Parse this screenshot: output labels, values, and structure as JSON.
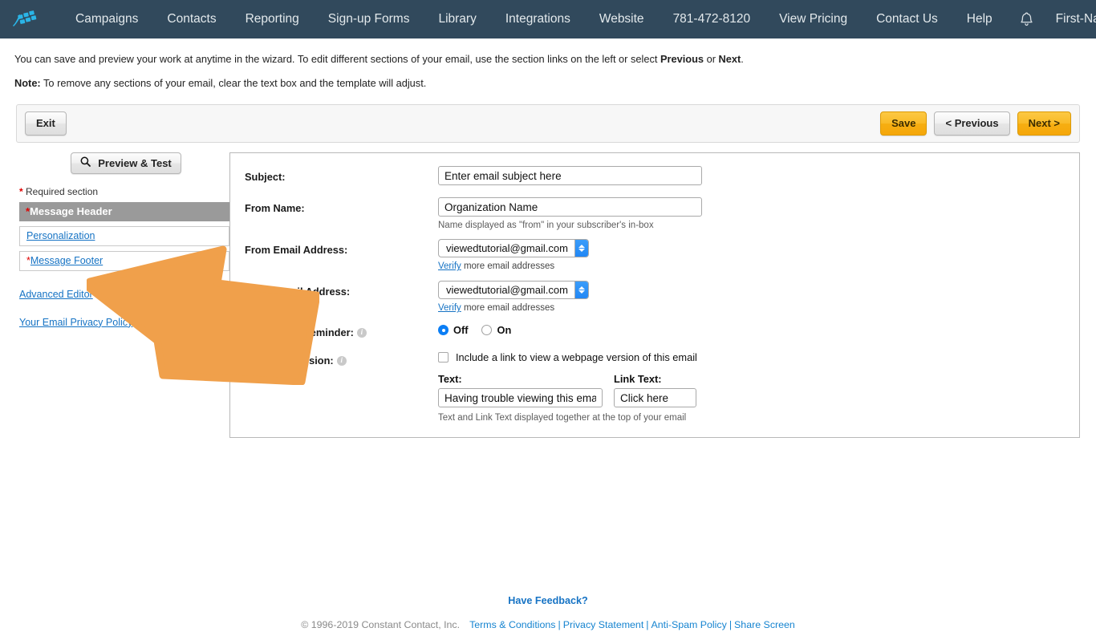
{
  "topnav": {
    "logo_icon": "constant-contact-flag-logo",
    "items": [
      {
        "label": "Campaigns"
      },
      {
        "label": "Contacts"
      },
      {
        "label": "Reporting"
      },
      {
        "label": "Sign-up Forms"
      },
      {
        "label": "Library"
      },
      {
        "label": "Integrations"
      },
      {
        "label": "Website"
      },
      {
        "label": "781-472-8120"
      },
      {
        "label": "View Pricing"
      },
      {
        "label": "Contact Us"
      },
      {
        "label": "Help"
      }
    ],
    "bell_icon": "notification-bell-icon",
    "user_name": "First-Name",
    "caret_icon": "chevron-down-icon",
    "bg_color": "#31495c"
  },
  "instructions": {
    "line1_part1": "You can save and preview your work at anytime in the wizard. To edit different sections of your email, use the section links on the left or select ",
    "line1_bold1": "Previous",
    "line1_part2": " or ",
    "line1_bold2": "Next",
    "line1_part3": ".",
    "line2_bold": "Note:",
    "line2_rest": " To remove any sections of your email, clear the text box and the template will adjust."
  },
  "actionbar": {
    "exit_label": "Exit",
    "save_label": "Save",
    "previous_label": "< Previous",
    "next_label": "Next >",
    "accent_color": "#f6ae12"
  },
  "sidebar": {
    "preview_label": "Preview & Test",
    "search_icon": "search-icon",
    "required_star": "*",
    "required_label": "Required section",
    "sections": [
      {
        "star": "*",
        "label": "Message Header",
        "type": "header"
      },
      {
        "star": "",
        "label": "Personalization",
        "type": "row"
      },
      {
        "star": "*",
        "label": "Message Footer",
        "type": "row"
      }
    ],
    "links": [
      {
        "label": "Advanced Editor"
      },
      {
        "label": "Your Email Privacy Policy"
      }
    ]
  },
  "form": {
    "subject": {
      "label": "Subject:",
      "value": "Enter email subject here",
      "placeholder": "Enter email subject here"
    },
    "from_name": {
      "label": "From Name:",
      "value": "Organization Name",
      "placeholder": "Organization Name",
      "hint": "Name displayed as \"from\" in your subscriber's in-box"
    },
    "from_email": {
      "label": "From Email Address:",
      "value": "viewedtutorial@gmail.com",
      "verify_link": "Verify",
      "verify_rest": " more email addresses"
    },
    "reply_email": {
      "label": "Reply Email Address:",
      "value": "viewedtutorial@gmail.com",
      "verify_link": "Verify",
      "verify_rest": " more email addresses"
    },
    "permission_reminder": {
      "label": "Permission Reminder:",
      "info_icon": "info-icon",
      "options": [
        {
          "label": "Off",
          "selected": true
        },
        {
          "label": "On",
          "selected": false
        }
      ]
    },
    "webpage_version": {
      "label": "Webpage Version:",
      "info_icon": "info-icon",
      "checkbox_label": "Include a link to view a webpage version of this email",
      "checked": false,
      "text_label": "Text:",
      "text_value": "Having trouble viewing this email?",
      "link_text_label": "Link Text:",
      "link_text_value": "Click here",
      "hint": "Text and Link Text displayed together at the top of your email"
    }
  },
  "annotation": {
    "arrow_icon": "orange-arrow-pointing-left",
    "color": "#f0a04b"
  },
  "footer": {
    "feedback": "Have Feedback?",
    "copyright": "© 1996-2019 Constant Contact, Inc.",
    "links": [
      {
        "label": "Terms & Conditions"
      },
      {
        "label": "Privacy Statement"
      },
      {
        "label": "Anti-Spam Policy"
      },
      {
        "label": "Share Screen"
      }
    ],
    "separator": "|"
  }
}
